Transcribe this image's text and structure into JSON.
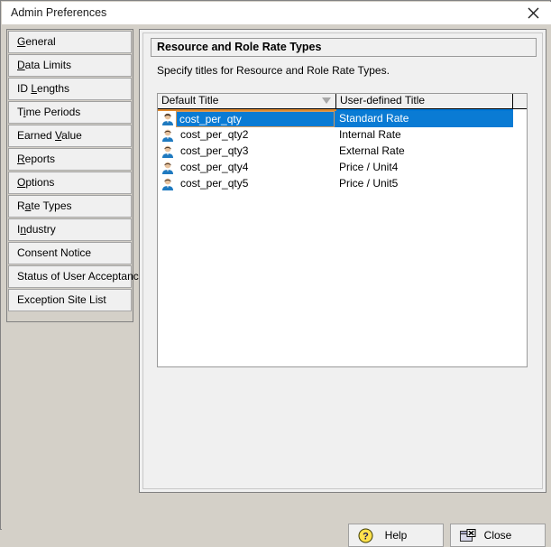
{
  "window": {
    "title": "Admin Preferences",
    "close_icon": "close-x-icon"
  },
  "sidebar": {
    "items": [
      {
        "label": "General",
        "pre": "",
        "mn": "G",
        "post": "eneral"
      },
      {
        "label": "Data Limits",
        "pre": "",
        "mn": "D",
        "post": "ata Limits"
      },
      {
        "label": "ID Lengths",
        "pre": "ID ",
        "mn": "L",
        "post": "engths"
      },
      {
        "label": "Time Periods",
        "pre": "T",
        "mn": "i",
        "post": "me Periods"
      },
      {
        "label": "Earned Value",
        "pre": "Earned ",
        "mn": "V",
        "post": "alue"
      },
      {
        "label": "Reports",
        "pre": "",
        "mn": "R",
        "post": "eports"
      },
      {
        "label": "Options",
        "pre": "",
        "mn": "O",
        "post": "ptions"
      },
      {
        "label": "Rate Types",
        "pre": "R",
        "mn": "a",
        "post": "te Types"
      },
      {
        "label": "Industry",
        "pre": "I",
        "mn": "n",
        "post": "dustry"
      },
      {
        "label": "Consent Notice",
        "pre": "Consent Notice",
        "mn": "",
        "post": ""
      },
      {
        "label": "Status of User Acceptance",
        "pre": "Status of User Acceptance",
        "mn": "",
        "post": ""
      },
      {
        "label": "Exception Site List",
        "pre": "Exception Site List",
        "mn": "",
        "post": ""
      }
    ]
  },
  "content": {
    "group_title": "Resource and Role Rate Types",
    "description": "Specify titles for Resource and Role Rate Types.",
    "table": {
      "columns": [
        "Default Title",
        "User-defined Title",
        ""
      ],
      "sort_indicator": "sort-descending-icon",
      "rows": [
        {
          "icon": "person-icon",
          "default_title": "cost_per_qty",
          "user_title": "Standard Rate",
          "selected": true
        },
        {
          "icon": "person-icon",
          "default_title": "cost_per_qty2",
          "user_title": "Internal Rate",
          "selected": false
        },
        {
          "icon": "person-icon",
          "default_title": "cost_per_qty3",
          "user_title": "External Rate",
          "selected": false
        },
        {
          "icon": "person-icon",
          "default_title": "cost_per_qty4",
          "user_title": "Price / Unit4",
          "selected": false
        },
        {
          "icon": "person-icon",
          "default_title": "cost_per_qty5",
          "user_title": "Price / Unit5",
          "selected": false
        }
      ]
    }
  },
  "footer": {
    "help_label": "Help",
    "help_icon": "question-mark-icon",
    "close_label": "Close",
    "close_icon": "window-close-icon"
  },
  "colors": {
    "selection_blue": "#0a7bd4",
    "edit_border_orange": "#d79b5c",
    "header_accent_orange": "#e08a2e",
    "header_accent_blue": "#0078d7",
    "dialog_face": "#d4d0c8",
    "panel_face": "#f0f0f0",
    "help_icon_yellow": "#ffe14d"
  }
}
